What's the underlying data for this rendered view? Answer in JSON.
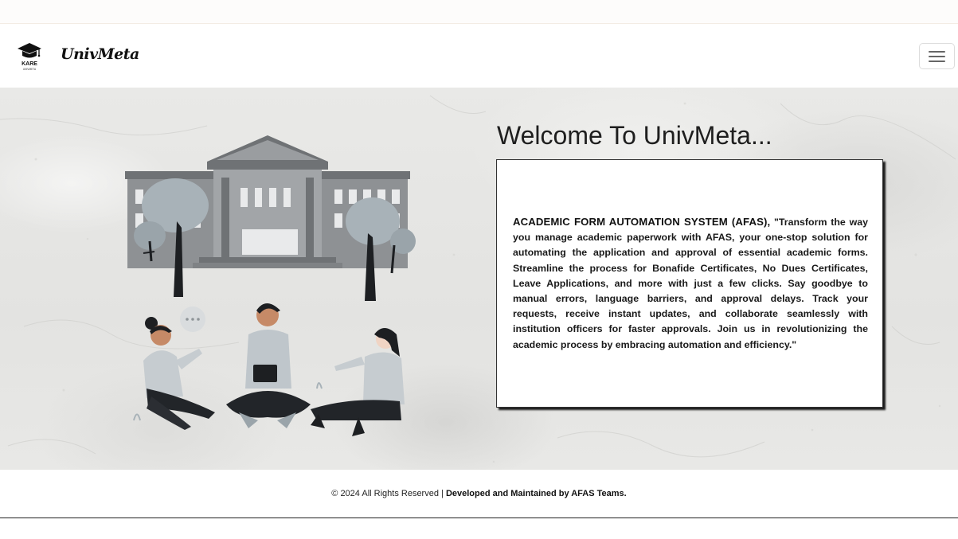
{
  "navbar": {
    "logo_text": "KARE",
    "logo_subtext": "UNIVMETA",
    "brand": "UnivMeta",
    "menu_toggle_label": "Toggle navigation"
  },
  "hero": {
    "welcome": "Welcome To UnivMeta...",
    "card": {
      "title": "ACADEMIC FORM AUTOMATION SYSTEM (AFAS),",
      "body": "\"Transform the way you manage academic paperwork with AFAS, your one-stop solution for automating the application and approval of essential academic forms. Streamline the process for Bonafide Certificates, No Dues Certificates, Leave Applications, and more with just a few clicks. Say goodbye to manual errors, language barriers, and approval delays. Track your requests, receive instant updates, and collaborate seamlessly with institution officers for faster approvals. Join us in revolutionizing the academic process by embracing automation and efficiency.\""
    },
    "illustration_icons": [
      "university-building-icon",
      "tree-icon",
      "student-group-icon",
      "speech-bubble-icon"
    ]
  },
  "footer": {
    "copyright": "© 2024 All Rights Reserved |",
    "credits": "Developed and Maintained by AFAS Teams."
  },
  "colors": {
    "hero_background": "#e7e7e5",
    "card_background": "#ffffff",
    "text_dark": "#1a1a1a",
    "building_gray": "#8c8e91",
    "illustration_gray": "#9ea6ac"
  }
}
